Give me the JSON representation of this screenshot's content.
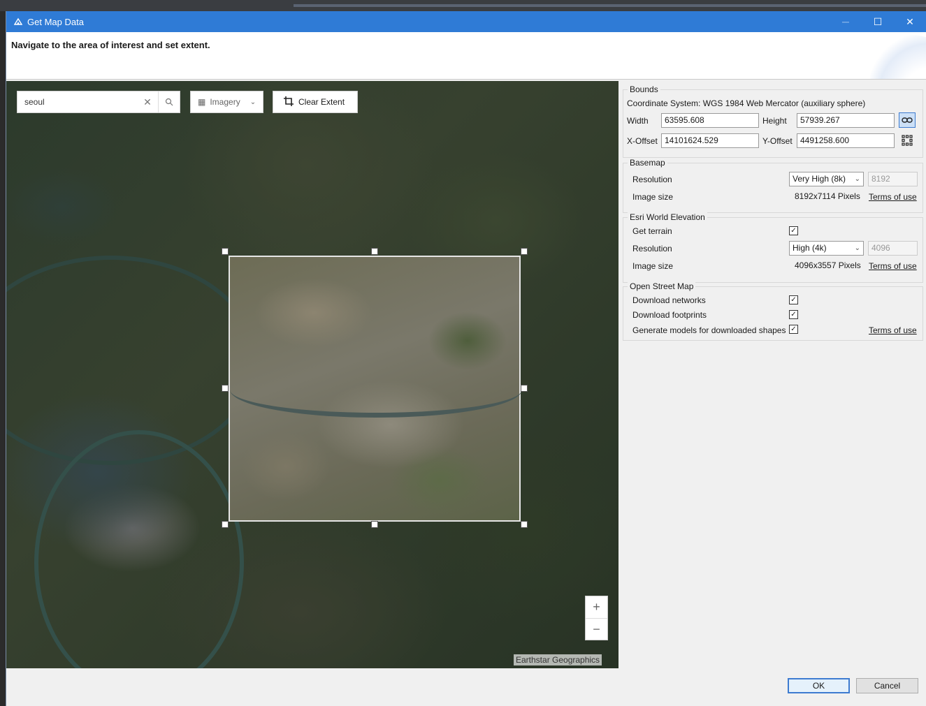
{
  "window": {
    "title": "Get Map Data",
    "app_icon": "app-logo-icon",
    "minimize": "─",
    "maximize": "☐",
    "close": "✕"
  },
  "header": {
    "instruction": "Navigate to the area of interest and set extent."
  },
  "map": {
    "search": {
      "value": "seoul",
      "clear_icon": "✕",
      "search_icon": "⌕"
    },
    "basemap": {
      "label": "Imagery",
      "icon": "▦",
      "chevron": "⌄"
    },
    "clear_extent": {
      "label": "Clear Extent",
      "icon": "⌗"
    },
    "zoom_in": "+",
    "zoom_out": "−",
    "attribution": "Earthstar Geographics"
  },
  "bounds": {
    "title": "Bounds",
    "coordinate_system": "Coordinate System: WGS 1984 Web Mercator (auxiliary sphere)",
    "width_label": "Width",
    "width": "63595.608",
    "height_label": "Height",
    "height": "57939.267",
    "xoffset_label": "X-Offset",
    "xoffset": "14101624.529",
    "yoffset_label": "Y-Offset",
    "yoffset": "4491258.600",
    "link_icon": "⚭",
    "grid_icon": "⋮⋮"
  },
  "basemap_group": {
    "title": "Basemap",
    "resolution_label": "Resolution",
    "resolution": "Very High (8k)",
    "resolution_value": "8192",
    "image_size_label": "Image size",
    "image_size": "8192x7114 Pixels",
    "terms": "Terms of use"
  },
  "elevation_group": {
    "title": "Esri World Elevation",
    "get_terrain_label": "Get terrain",
    "get_terrain": true,
    "resolution_label": "Resolution",
    "resolution": "High (4k)",
    "resolution_value": "4096",
    "image_size_label": "Image size",
    "image_size": "4096x3557 Pixels",
    "terms": "Terms of use"
  },
  "osm_group": {
    "title": "Open Street Map",
    "download_networks_label": "Download networks",
    "download_networks": true,
    "download_footprints_label": "Download footprints",
    "download_footprints": true,
    "generate_models_label": "Generate models for downloaded shapes",
    "generate_models": true,
    "terms": "Terms of use"
  },
  "footer": {
    "ok": "OK",
    "cancel": "Cancel"
  },
  "check_mark": "✓"
}
